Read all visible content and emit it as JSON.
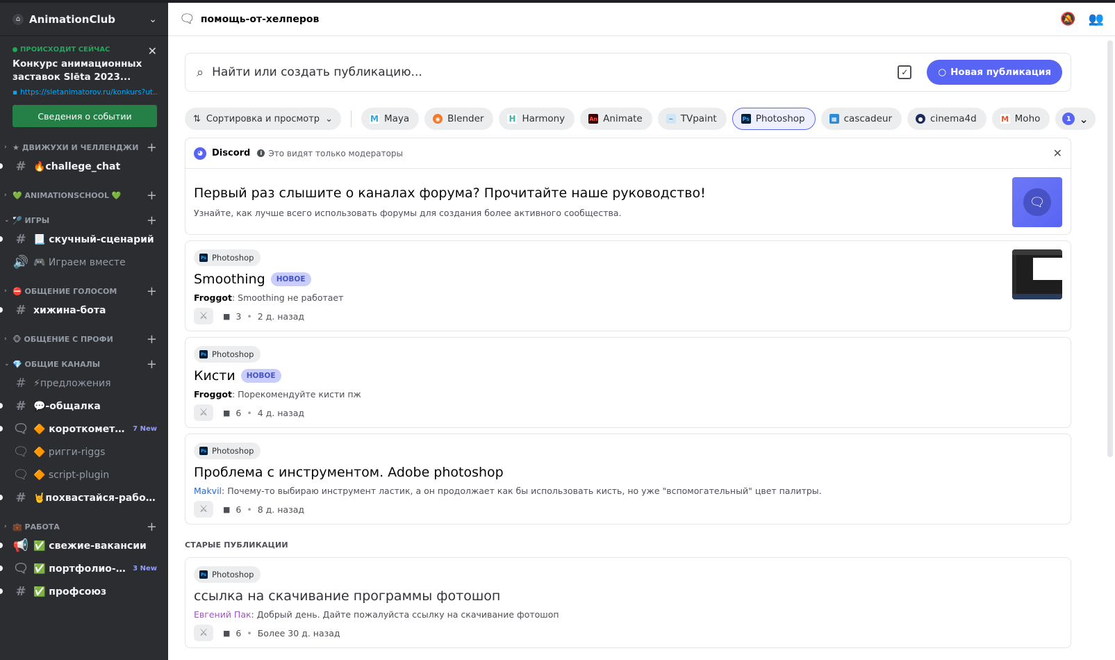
{
  "sidebar": {
    "server_name": "AnimationClub",
    "event": {
      "live_label": "ПРОИСХОДИТ СЕЙЧАС",
      "title": "Конкурс анимационных заставок Slēta 2023...",
      "link": "https://sletanimatorov.ru/konkurs?ut...",
      "button": "Сведения о событии"
    },
    "cat_1": "★ ДВИЖУХИ И ЧЕЛЛЕНДЖИ",
    "ch_challege": "🔥challege_chat",
    "cat_2": "💚 ANIMATIONSCHOOL 💚",
    "cat_3": "🏸 ИГРЫ",
    "ch_scenario": "📃 скучный-сценарий",
    "ch_play": "🎮 Играем вместе",
    "cat_4": "⛔ ОБЩЕНИЕ ГОЛОСОМ",
    "ch_hut": "хижина-бота",
    "cat_5": "🐵 ОБЩЕНИЕ С ПРОФИ",
    "cat_6": "💎 ОБЩИЕ КАНАЛЫ",
    "ch_suggest": "⚡предложения",
    "ch_talk": "💬-общалка",
    "ch_short": "🔶 короткометра...",
    "ch_short_new": "7 New",
    "ch_rig": "🔶 ригги-riggs",
    "ch_script": "🔶 script-plugin",
    "ch_brag": "🤘похвастайся-работой",
    "cat_7": "💼 РАБОТА",
    "ch_jobs": "✅ свежие-вакансии",
    "ch_portfolio": "✅ портфолио-уч...",
    "ch_portfolio_new": "3 New",
    "ch_union": "✅ профсоюз"
  },
  "topbar": {
    "channel_name": "помощь-от-хелперов"
  },
  "search": {
    "placeholder": "Найти или создать публикацию...",
    "new_post": "Новая публикация"
  },
  "tags": {
    "sort": "Сортировка и просмотр",
    "list": [
      "Maya",
      "Blender",
      "Harmony",
      "Animate",
      "TVpaint",
      "Photoshop",
      "cascadeur",
      "cinema4d",
      "Moho"
    ],
    "more_count": "1"
  },
  "notice": {
    "brand": "Discord",
    "visibility": "Это видят только модераторы",
    "title": "Первый раз слышите о каналах форума? Прочитайте наше руководство!",
    "subtitle": "Узнайте, как лучше всего использовать форумы для создания более активного сообщества."
  },
  "new_badge": "НОВОЕ",
  "posts": [
    {
      "tag": "Photoshop",
      "title": "Smoothing",
      "author": "Froggot",
      "text": "Smoothing не работает",
      "replies": "3",
      "age": "2 д. назад"
    },
    {
      "tag": "Photoshop",
      "title": "Кисти",
      "author": "Froggot",
      "text": "Порекомендуйте кисти пж",
      "replies": "6",
      "age": "4 д. назад"
    },
    {
      "tag": "Photoshop",
      "title": "Проблема с инструментом. Adobe photoshop",
      "author": "Makvil",
      "text": "Почему-то выбираю инструмент ластик, а он продолжает как бы использовать кисть, но уже \"вспомогательный\" цвет палитры.",
      "replies": "6",
      "age": "8 д. назад"
    }
  ],
  "old_section": "СТАРЫЕ ПУБЛИКАЦИИ",
  "old_posts": [
    {
      "tag": "Photoshop",
      "title": "ссылка на скачивание программы фотошоп",
      "author": "Евгений Пак",
      "text": "Добрый день. Дайте пожалуйста ссылку на скачивание фотошоп",
      "replies": "6",
      "age": "Более 30 д. назад"
    }
  ]
}
